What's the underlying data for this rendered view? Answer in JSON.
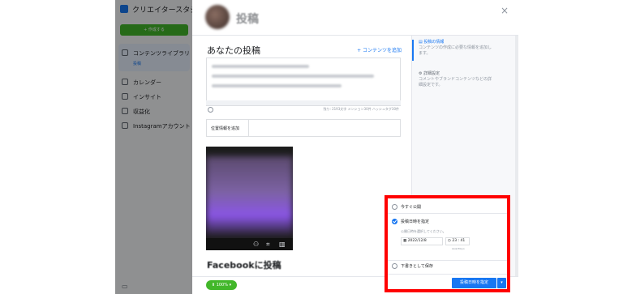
{
  "sidebar": {
    "title": "クリエイタースタジオ",
    "create_label": "+ 作成する",
    "items": [
      {
        "label": "コンテンツライブラリ"
      },
      {
        "label": "カレンダー"
      },
      {
        "label": "インサイト"
      },
      {
        "label": "収益化"
      },
      {
        "label": "Instagramアカウント"
      }
    ],
    "active_sub": "投稿"
  },
  "modal": {
    "title": "投稿",
    "close": "×",
    "section_title": "あなたの投稿",
    "add_content": "+ コンテンツを追加",
    "counter": "残り: 2193文字 メンション30件 ハッシュタグ30件",
    "location_label": "位置情報を追加",
    "facebook_heading": "Facebookに投稿",
    "right_panel": {
      "item1_title": "投稿の情報",
      "item1_desc_1": "コンテンツの作成に必要な情報を追加し",
      "item1_desc_2": "ます。",
      "item2_title": "詳細設定",
      "item2_desc_1": "コメントやブランドコンテンツなどの詳",
      "item2_desc_2": "細設定です。"
    },
    "zoom_label": "100%"
  },
  "schedule": {
    "opt_now": "今すぐ公開",
    "opt_schedule": "投稿日時を指定",
    "hint": "公開日時を選択してください。",
    "date": "2022/12/8",
    "time": "23 : 41",
    "timezone": "Asia/Tokyo",
    "opt_draft": "下書きとして保存",
    "button_label": "投稿日時を指定",
    "dropdown": "▾"
  },
  "colors": {
    "accent": "#1877f2",
    "green": "#42b72a",
    "highlight": "#ff0000"
  }
}
